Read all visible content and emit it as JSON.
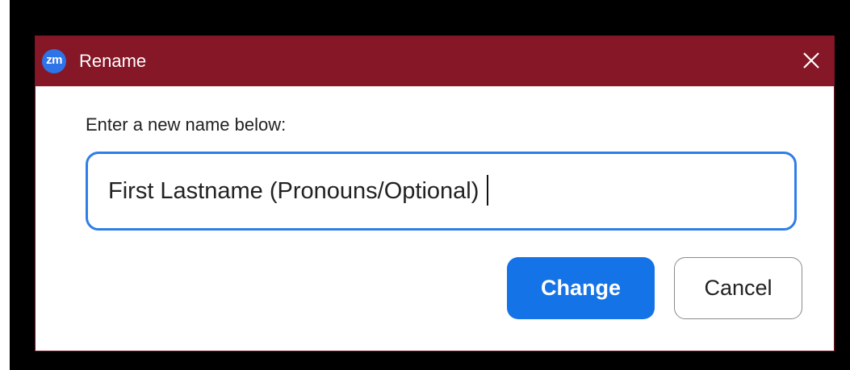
{
  "window": {
    "app_icon_text": "zm",
    "title": "Rename",
    "close_icon": "close-icon"
  },
  "dialog": {
    "prompt": "Enter a new name below:",
    "name_input": {
      "value": "First Lastname (Pronouns/Optional)"
    },
    "buttons": {
      "change_label": "Change",
      "cancel_label": "Cancel"
    }
  },
  "colors": {
    "titlebar": "#861727",
    "accent": "#1473e6",
    "input_border": "#2e7ee6",
    "app_icon": "#2d74e8"
  }
}
